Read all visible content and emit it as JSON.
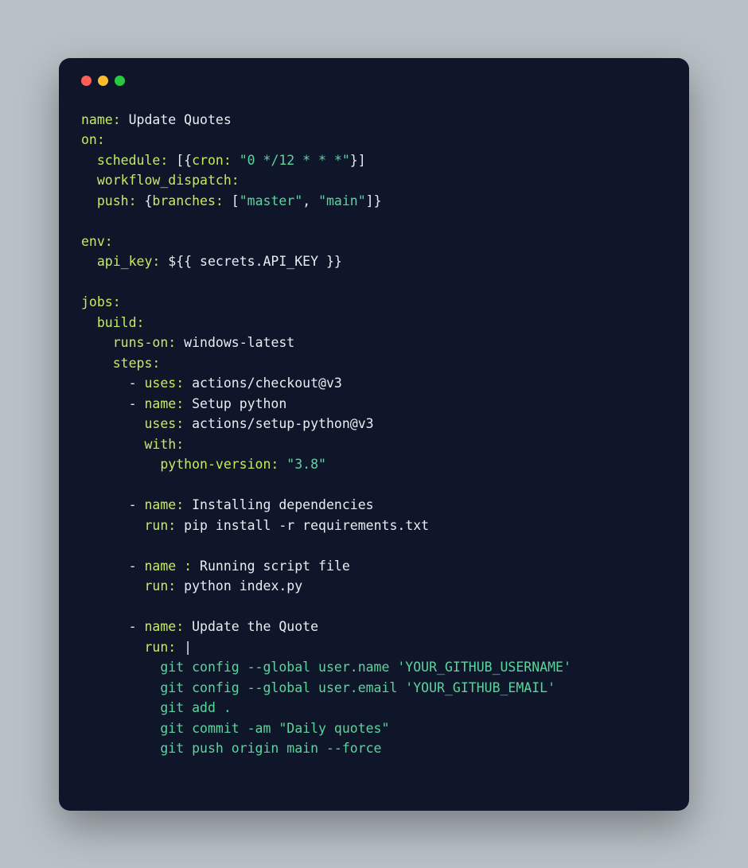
{
  "yaml": {
    "name_key": "name:",
    "name_val": "Update Quotes",
    "on_key": "on:",
    "schedule_key": "schedule:",
    "cron_key": "cron:",
    "cron_val": "\"0 */12 * * *\"",
    "workflow_dispatch_key": "workflow_dispatch:",
    "push_key": "push:",
    "branches_key": "branches:",
    "branch_master": "\"master\"",
    "branch_main": "\"main\"",
    "env_key": "env:",
    "api_key_key": "api_key:",
    "api_key_val": "${{ secrets.API_KEY }}",
    "jobs_key": "jobs:",
    "build_key": "build:",
    "runs_on_key": "runs-on:",
    "runs_on_val": "windows-latest",
    "steps_key": "steps:",
    "uses_key": "uses:",
    "checkout_val": "actions/checkout@v3",
    "name1_key": "name:",
    "name1_val": "Setup python",
    "setup_python_val": "actions/setup-python@v3",
    "with_key": "with:",
    "python_version_key": "python-version:",
    "python_version_val": "\"3.8\"",
    "name2_val": "Installing dependencies",
    "run_key": "run:",
    "run2_val": "pip install -r requirements.txt",
    "name3_key": "name :",
    "name3_val": "Running script file",
    "run3_val": "python index.py",
    "name4_val": "Update the Quote",
    "pipe": "|",
    "dash": "- ",
    "comma": ", ",
    "lbracket": "[",
    "rbracket": "]",
    "lbrace": "{",
    "rbrace": "}",
    "lbracket_brace": " [{",
    "rbrace_bracket": "}]",
    "space": " ",
    "shell_line1": "git config --global user.name 'YOUR_GITHUB_USERNAME'",
    "shell_line2": "git config --global user.email 'YOUR_GITHUB_EMAIL'",
    "shell_line3": "git add .",
    "shell_line4": "git commit -am \"Daily quotes\"",
    "shell_line5": "git push origin main --force"
  }
}
